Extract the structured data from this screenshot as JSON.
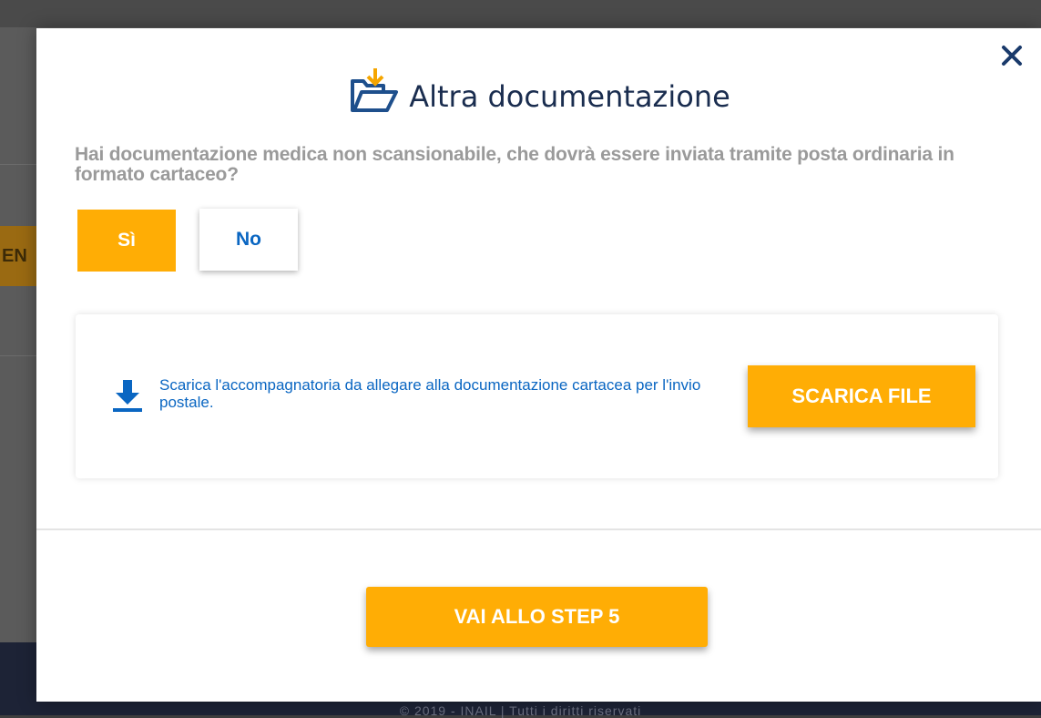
{
  "background": {
    "side_tab_text": "EN",
    "footer_text": "© 2019 - INAIL | Tutti i diritti riservati"
  },
  "modal": {
    "title": "Altra documentazione",
    "title_icon": "folder-download-icon",
    "close_icon": "close-icon",
    "question": "Hai documentazione medica non scansionabile, che dovrà essere inviata tramite posta ordinaria in formato cartaceo?",
    "yes_label": "Sì",
    "no_label": "No",
    "download": {
      "icon": "download-icon",
      "text": "Scarica l'accompagnatoria da allegare alla documentazione cartacea per l'invio postale.",
      "button_label": "SCARICA FILE"
    },
    "next_label": "VAI ALLO STEP 5"
  },
  "colors": {
    "accent": "#ffad05",
    "link": "#0a66c2",
    "title": "#1a2d4f"
  }
}
